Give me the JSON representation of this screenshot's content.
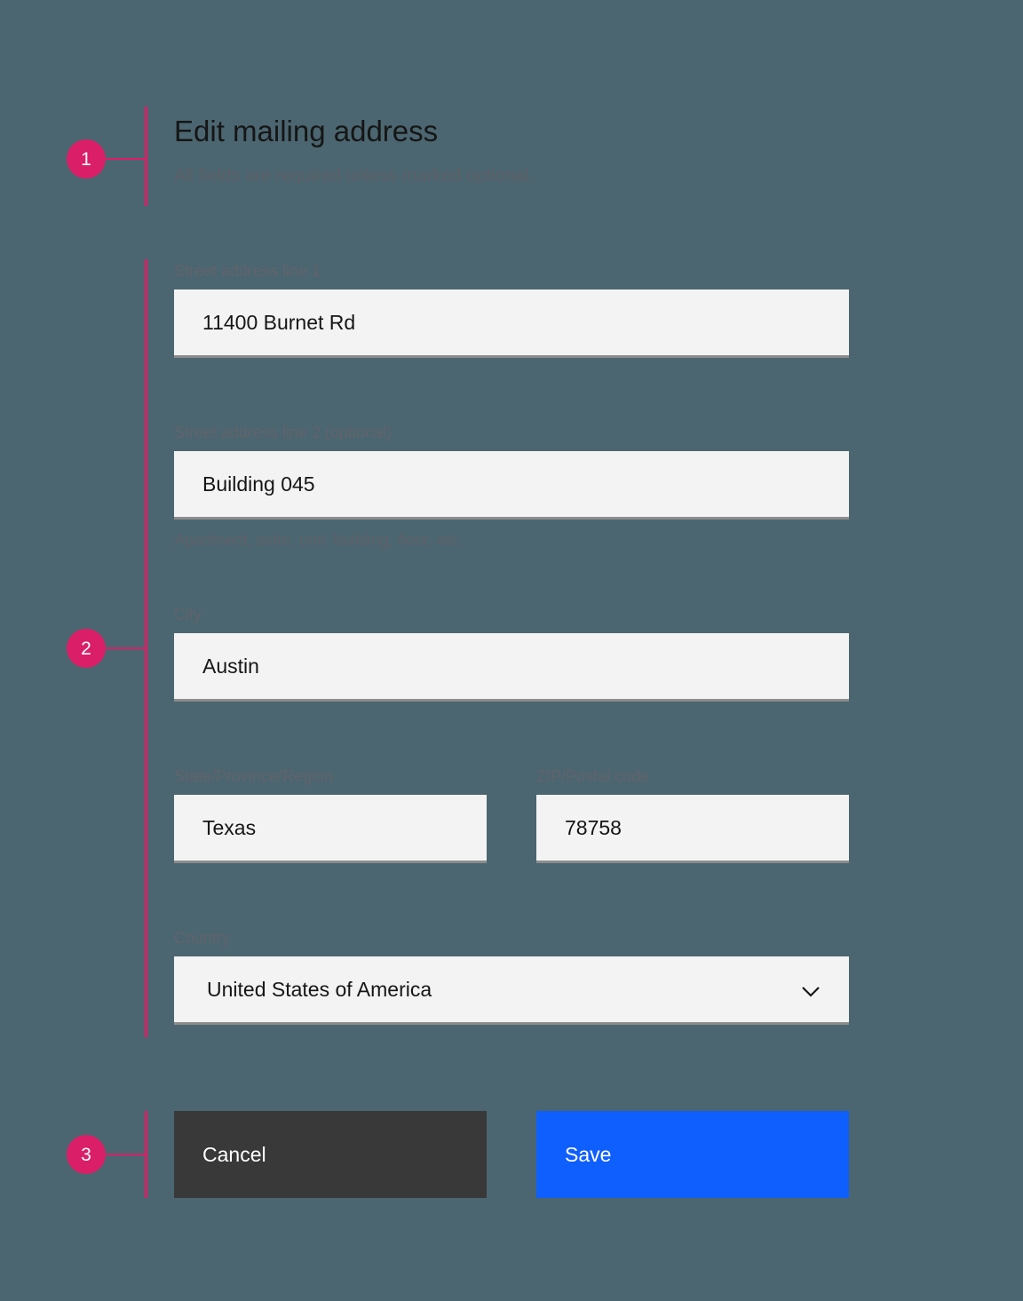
{
  "theme": {
    "background": "#4b6670",
    "annotation": "#da1e67",
    "field_bg": "#f3f3f3",
    "field_border": "#8c8c8c",
    "cancel_bg": "#393939",
    "save_bg": "#0f5ffe",
    "title_color": "#161616",
    "label_color": "#61636b"
  },
  "annotations": [
    {
      "number": "1"
    },
    {
      "number": "2"
    },
    {
      "number": "3"
    }
  ],
  "form": {
    "title": "Edit mailing address",
    "subtitle": "All fields are required unless marked optional.",
    "fields": [
      {
        "label": "Street address line 1",
        "value": "11400 Burnet Rd",
        "placeholder": "",
        "helper": ""
      },
      {
        "label": "Street address line 2 (optional)",
        "value": "Building 045",
        "placeholder": "",
        "helper": "Apartment, suite, unit, building, floor, etc."
      },
      {
        "label": "City",
        "value": "Austin",
        "placeholder": "",
        "helper": ""
      },
      {
        "label": "State/Province/Region",
        "value": "Texas",
        "placeholder": "",
        "helper": ""
      },
      {
        "label": "ZIP/Postal code",
        "value": "78758",
        "placeholder": "",
        "helper": ""
      }
    ],
    "country": {
      "label": "Country",
      "value": "United States of America",
      "icon": "chevron-down-icon"
    }
  },
  "actions": {
    "cancel_label": "Cancel",
    "save_label": "Save"
  }
}
